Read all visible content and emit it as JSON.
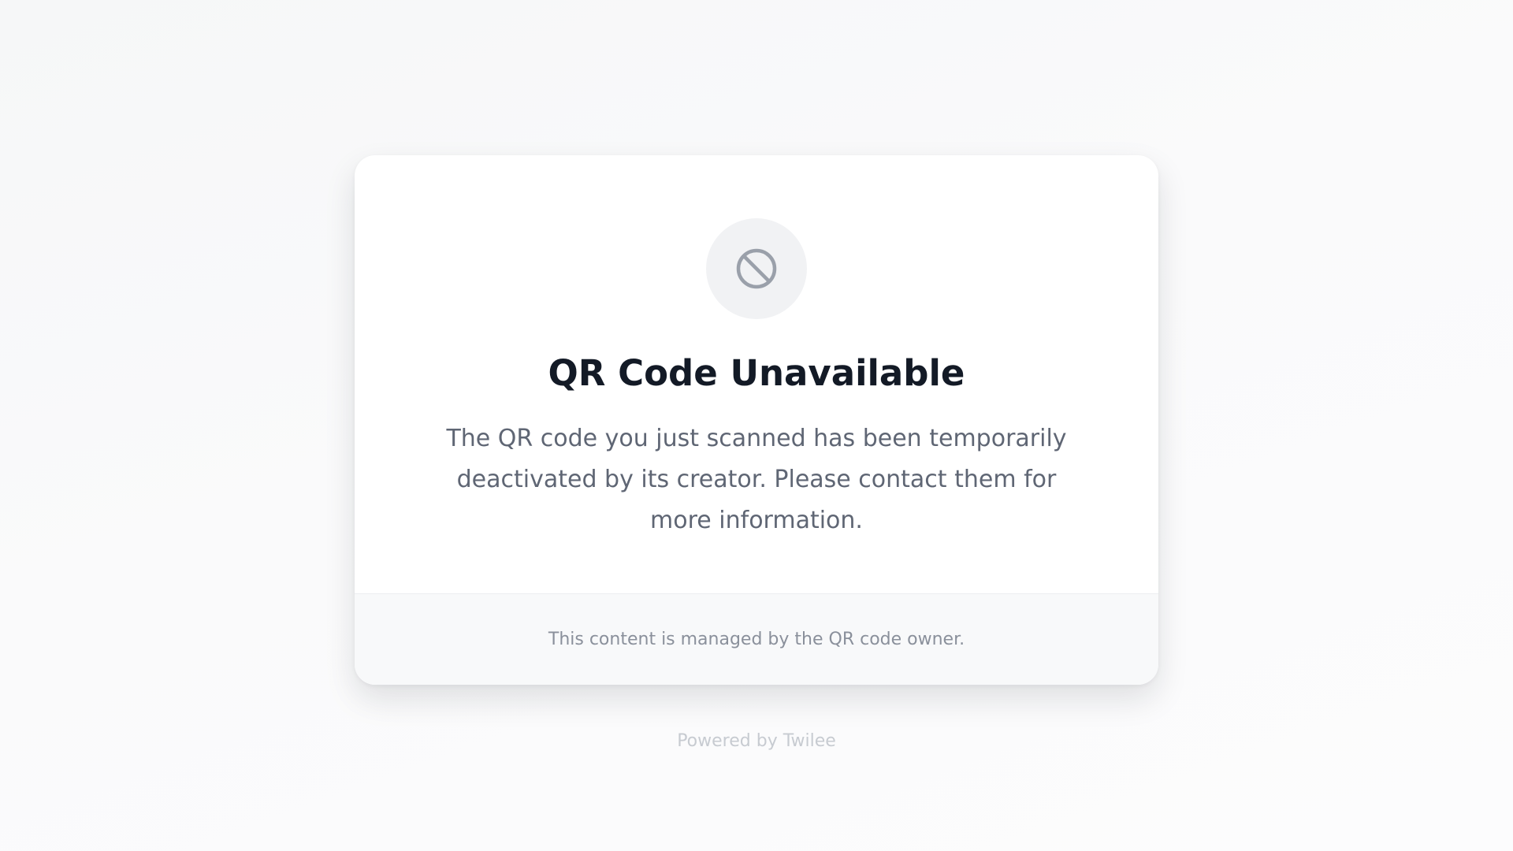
{
  "card": {
    "icon": "ban-icon",
    "title": "QR Code Unavailable",
    "message": "The QR code you just scanned has been temporarily deactivated by its creator. Please contact them for more information.",
    "footer_note": "This content is managed by the QR code owner."
  },
  "powered_by": "Powered by Twilee",
  "colors": {
    "title": "#131a26",
    "message": "#5f6674",
    "icon_stroke": "#9aa0aa",
    "icon_bg": "#f1f2f4",
    "footer_bg": "#f8f9fa"
  }
}
